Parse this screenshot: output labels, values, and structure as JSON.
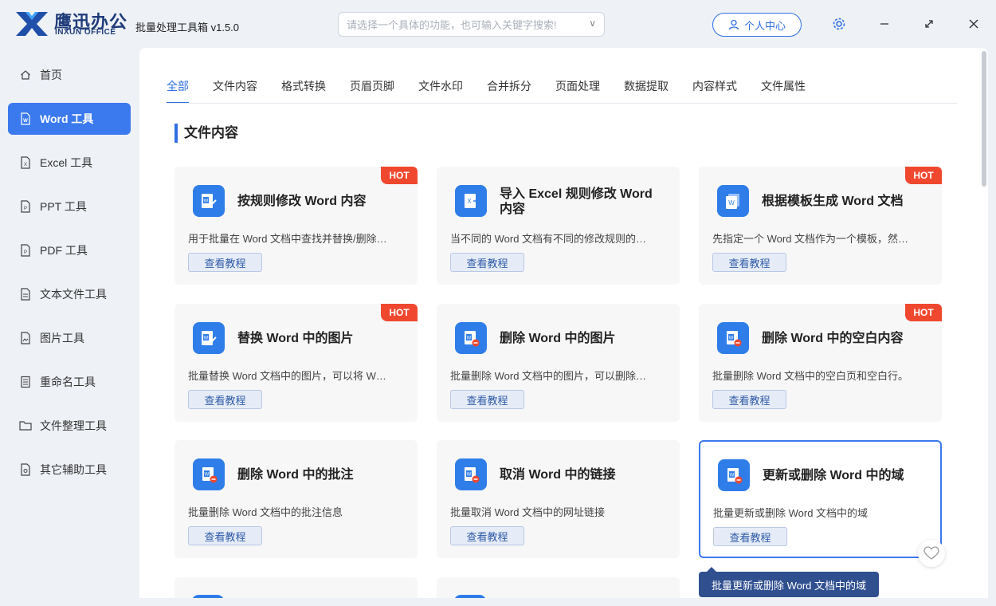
{
  "app": {
    "brand_cn": "鹰迅办公",
    "brand_en": "INXUN OFFICE",
    "title": "批量处理工具箱 v1.5.0",
    "search_placeholder": "请选择一个具体的功能，也可输入关键字搜索!",
    "user_center": "个人中心",
    "accent": "#2f6fe3"
  },
  "sidebar": {
    "items": [
      {
        "label": "首页",
        "icon": "home-icon"
      },
      {
        "label": "Word 工具",
        "icon": "word-file-icon"
      },
      {
        "label": "Excel 工具",
        "icon": "excel-file-icon"
      },
      {
        "label": "PPT 工具",
        "icon": "ppt-file-icon"
      },
      {
        "label": "PDF 工具",
        "icon": "pdf-file-icon"
      },
      {
        "label": "文本文件工具",
        "icon": "text-file-icon"
      },
      {
        "label": "图片工具",
        "icon": "image-file-icon"
      },
      {
        "label": "重命名工具",
        "icon": "rename-icon"
      },
      {
        "label": "文件整理工具",
        "icon": "folder-icon"
      },
      {
        "label": "其它辅助工具",
        "icon": "tools-icon"
      }
    ],
    "active": "Word 工具"
  },
  "tabs": [
    "全部",
    "文件内容",
    "格式转换",
    "页眉页脚",
    "文件水印",
    "合并拆分",
    "页面处理",
    "数据提取",
    "内容样式",
    "文件属性"
  ],
  "active_tab": "全部",
  "section_title": "文件内容",
  "cards": [
    {
      "title": "按规则修改 Word 内容",
      "desc": "用于批量在 Word 文档中查找并替换/删除…",
      "button": "查看教程",
      "hot": "HOT"
    },
    {
      "title": "导入 Excel 规则修改 Word 内容",
      "desc": "当不同的 Word 文档有不同的修改规则的…",
      "button": "查看教程",
      "hot": ""
    },
    {
      "title": "根据模板生成 Word 文档",
      "desc": "先指定一个 Word 文档作为一个模板，然…",
      "button": "查看教程",
      "hot": "HOT"
    },
    {
      "title": "替换 Word 中的图片",
      "desc": "批量替换 Word 文档中的图片，可以将 W…",
      "button": "查看教程",
      "hot": "HOT"
    },
    {
      "title": "删除 Word 中的图片",
      "desc": "批量删除 Word 文档中的图片，可以删除…",
      "button": "查看教程",
      "hot": ""
    },
    {
      "title": "删除 Word 中的空白内容",
      "desc": "批量删除 Word 文档中的空白页和空白行。",
      "button": "查看教程",
      "hot": "HOT"
    },
    {
      "title": "删除 Word 中的批注",
      "desc": "批量删除 Word 文档中的批注信息",
      "button": "查看教程",
      "hot": ""
    },
    {
      "title": "取消 Word 中的链接",
      "desc": "批量取消 Word 文档中的网址链接",
      "button": "查看教程",
      "hot": ""
    },
    {
      "title": "更新或删除 Word 中的域",
      "desc": "批量更新或删除 Word 文档中的域",
      "button": "查看教程",
      "hot": ""
    }
  ],
  "tooltip": "批量更新或删除 Word 文档中的域"
}
